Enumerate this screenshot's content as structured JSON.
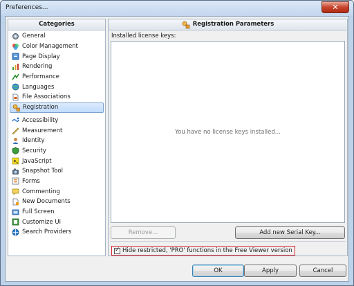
{
  "window": {
    "title": "Preferences...",
    "close_glyph": "✕"
  },
  "categories": {
    "header": "Categories",
    "items": [
      {
        "label": "General",
        "icon": "general-icon"
      },
      {
        "label": "Color Management",
        "icon": "color-management-icon"
      },
      {
        "label": "Page Display",
        "icon": "page-display-icon"
      },
      {
        "label": "Rendering",
        "icon": "rendering-icon"
      },
      {
        "label": "Performance",
        "icon": "performance-icon"
      },
      {
        "label": "Languages",
        "icon": "languages-icon"
      },
      {
        "label": "File Associations",
        "icon": "file-associations-icon"
      },
      {
        "label": "Registration",
        "icon": "registration-icon",
        "selected": true
      },
      {
        "label": "Accessibility",
        "icon": "accessibility-icon"
      },
      {
        "label": "Measurement",
        "icon": "measurement-icon"
      },
      {
        "label": "Identity",
        "icon": "identity-icon"
      },
      {
        "label": "Security",
        "icon": "security-icon"
      },
      {
        "label": "JavaScript",
        "icon": "javascript-icon"
      },
      {
        "label": "Snapshot Tool",
        "icon": "snapshot-tool-icon"
      },
      {
        "label": "Forms",
        "icon": "forms-icon"
      },
      {
        "label": "Commenting",
        "icon": "commenting-icon"
      },
      {
        "label": "New Documents",
        "icon": "new-documents-icon"
      },
      {
        "label": "Full Screen",
        "icon": "full-screen-icon"
      },
      {
        "label": "Customize UI",
        "icon": "customize-ui-icon"
      },
      {
        "label": "Search Providers",
        "icon": "search-providers-icon"
      }
    ]
  },
  "registration": {
    "header": "Registration Parameters",
    "installed_label": "Installed license keys:",
    "empty_message": "You have no license keys installed...",
    "remove_button": "Remove...",
    "add_button": "Add new Serial Key...",
    "hide_checkbox_label": "Hide restricted, 'PRO' functions in the Free Viewer version",
    "hide_checked": true
  },
  "footer": {
    "ok": "OK",
    "apply": "Apply",
    "cancel": "Cancel"
  },
  "colors": {
    "selection": "#c1dcfc",
    "highlight_border": "#d7232e"
  }
}
